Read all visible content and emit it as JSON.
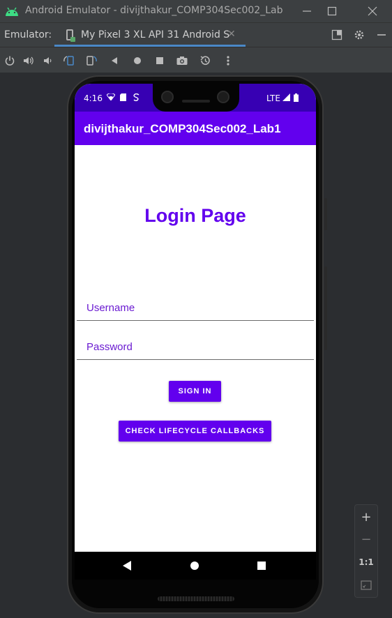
{
  "window": {
    "title": "Android Emulator - divijthakur_COMP304Sec002_Lab",
    "icons": [
      "android-logo",
      "minimize-icon",
      "maximize-icon",
      "close-icon"
    ]
  },
  "tabbar": {
    "label": "Emulator:",
    "tab_title": "My Pixel 3 XL API 31 Android S",
    "tab_close": "✕"
  },
  "toolbar": {
    "icons": [
      "power-icon",
      "volume-up-icon",
      "volume-down-icon",
      "rotate-left-icon",
      "rotate-right-icon",
      "back-icon",
      "home-icon",
      "overview-icon",
      "screenshot-icon",
      "snapshot-icon",
      "more-icon"
    ]
  },
  "status_bar": {
    "time": "4:16",
    "network": "LTE"
  },
  "app": {
    "title": "divijthakur_COMP304Sec002_Lab1",
    "heading": "Login Page",
    "username_placeholder": "Username",
    "password_placeholder": "Password",
    "sign_in": "SIGN IN",
    "lifecycle": "CHECK LIFECYCLE CALLBACKS"
  },
  "zoom_controls": {
    "plus": "+",
    "minus": "−",
    "one_to_one": "1:1"
  },
  "colors": {
    "primary": "#6200ee",
    "primary_dark": "#3700b3"
  }
}
